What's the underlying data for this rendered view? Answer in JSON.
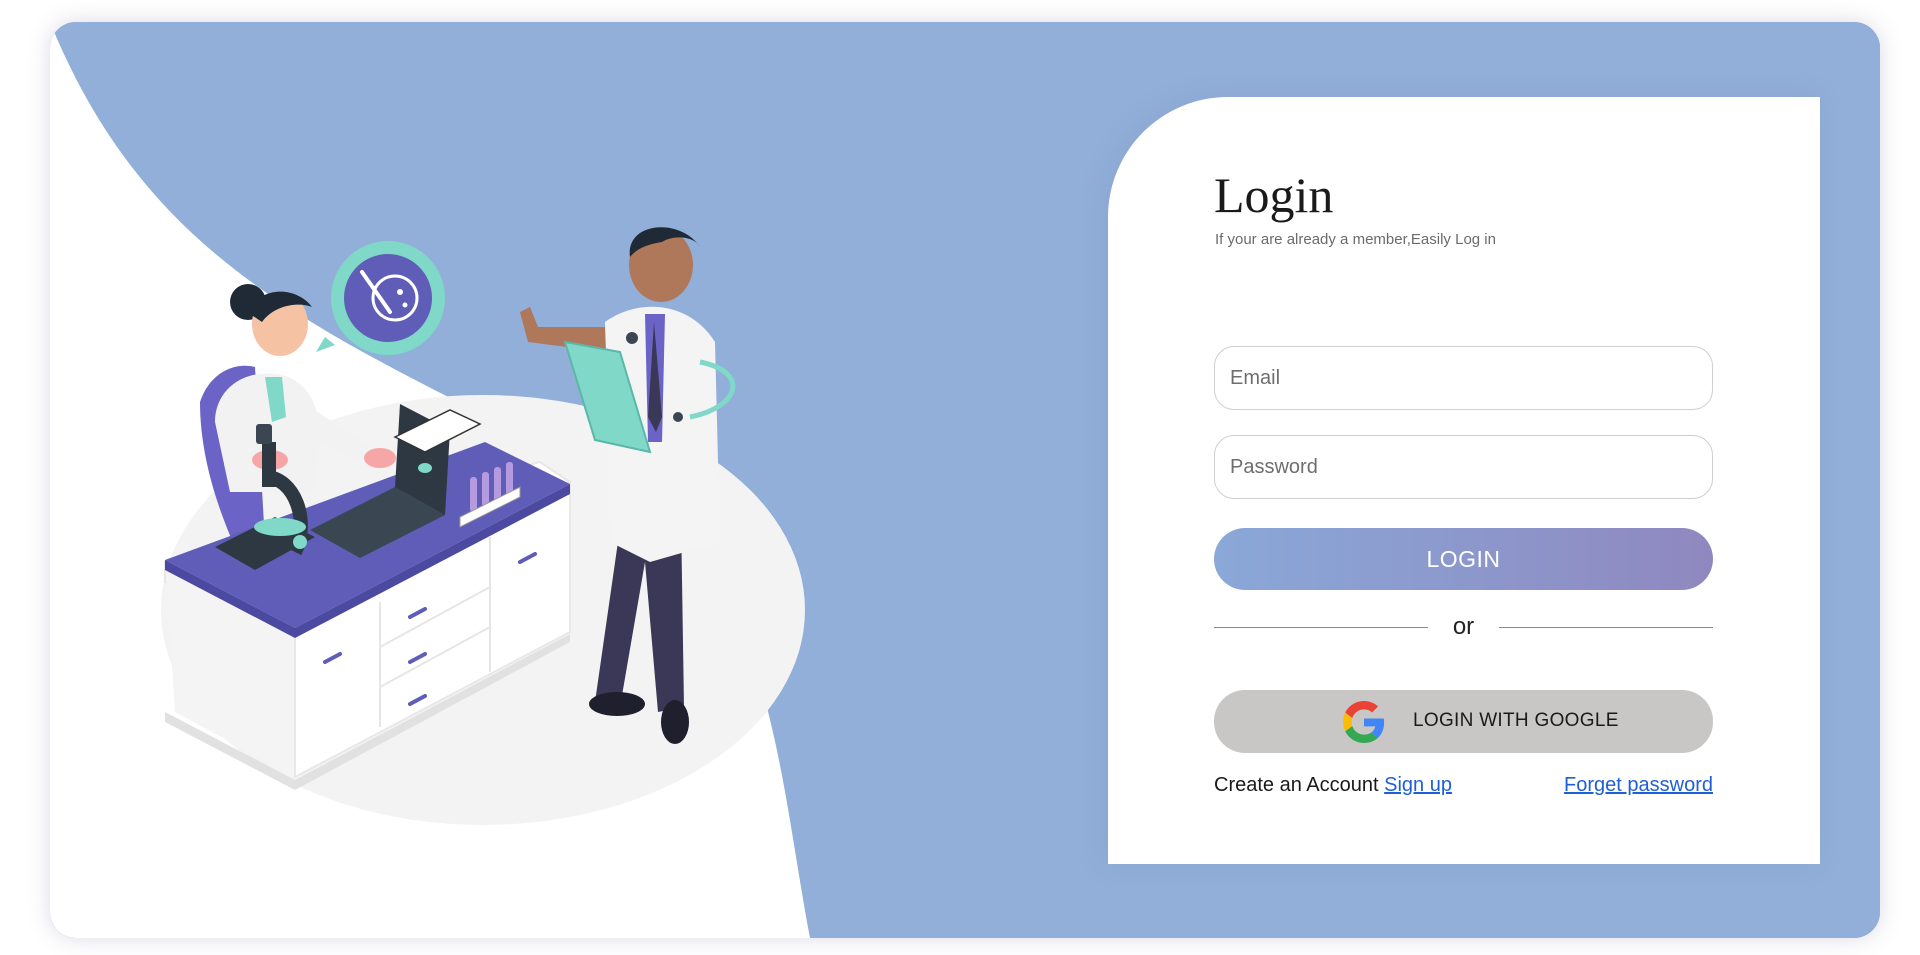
{
  "login": {
    "title": "Login",
    "subtitle": "If your are already a member,Easily Log in",
    "email_placeholder": "Email",
    "password_placeholder": "Password",
    "login_button": "LOGIN",
    "divider_text": "or",
    "google_button": "LOGIN WITH GOOGLE",
    "create_account_text": "Create an Account",
    "signup_link": "Sign up",
    "forget_link": "Forget password"
  },
  "icons": {
    "google": "google-logo-icon",
    "petri_dish": "petri-dish-icon"
  },
  "colors": {
    "card_background": "#91afd9",
    "login_gradient_start": "#8aa8d8",
    "login_gradient_end": "#8f88bf",
    "google_button": "#c8c7c6",
    "link": "#1f5fd6"
  }
}
